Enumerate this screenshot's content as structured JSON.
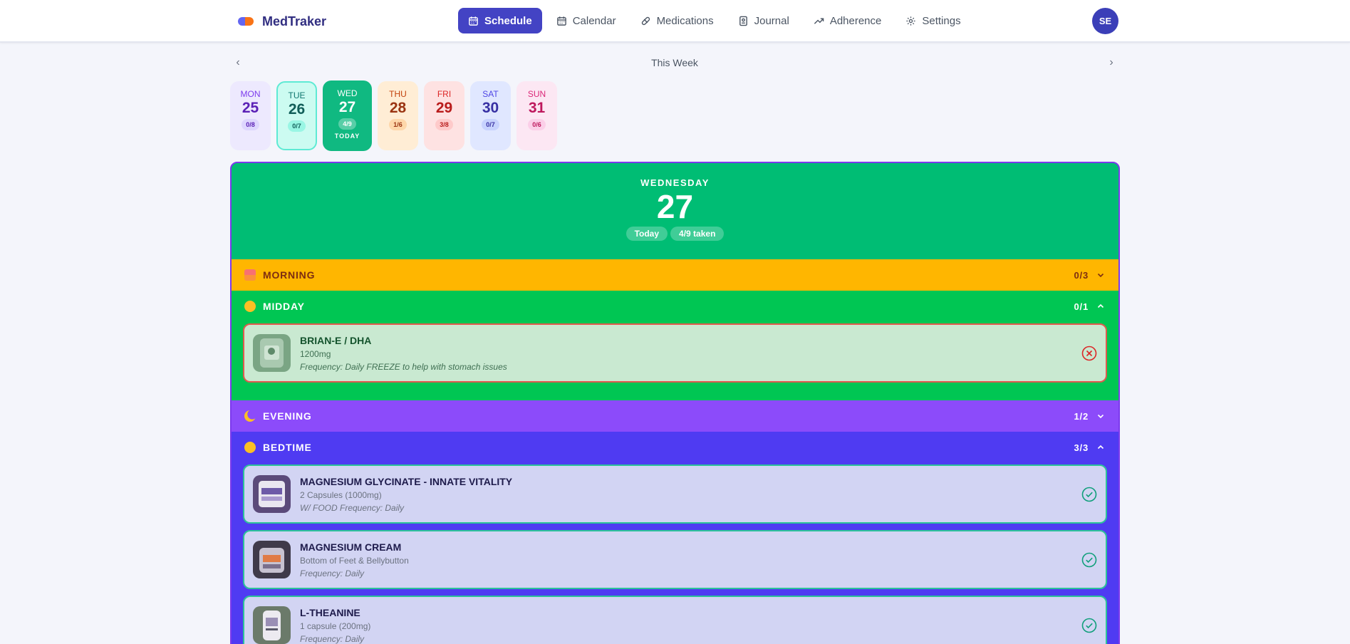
{
  "app": {
    "name": "MedTraker",
    "user_initials": "SE"
  },
  "nav": [
    {
      "label": "Schedule",
      "icon": "calendar-icon",
      "active": true
    },
    {
      "label": "Calendar",
      "icon": "calendar-icon",
      "active": false
    },
    {
      "label": "Medications",
      "icon": "pill-icon",
      "active": false
    },
    {
      "label": "Journal",
      "icon": "journal-icon",
      "active": false
    },
    {
      "label": "Adherence",
      "icon": "trending-up-icon",
      "active": false
    },
    {
      "label": "Settings",
      "icon": "gear-icon",
      "active": false
    }
  ],
  "week": {
    "title": "This Week",
    "days": [
      {
        "name": "MON",
        "num": "25",
        "count": "0/8"
      },
      {
        "name": "TUE",
        "num": "26",
        "count": "0/7"
      },
      {
        "name": "WED",
        "num": "27",
        "count": "4/9",
        "today_label": "TODAY"
      },
      {
        "name": "THU",
        "num": "28",
        "count": "1/6"
      },
      {
        "name": "FRI",
        "num": "29",
        "count": "3/8"
      },
      {
        "name": "SAT",
        "num": "30",
        "count": "0/7"
      },
      {
        "name": "SUN",
        "num": "31",
        "count": "0/6"
      }
    ]
  },
  "selected_day": {
    "weekday": "WEDNESDAY",
    "num": "27",
    "badge_today": "Today",
    "badge_taken": "4/9 taken"
  },
  "sections": {
    "morning": {
      "label": "MORNING",
      "count": "0/3",
      "icon": "sunrise-icon",
      "expanded": false
    },
    "midday": {
      "label": "MIDDAY",
      "count": "0/1",
      "icon": "sun-face-icon",
      "expanded": true,
      "meds": [
        {
          "name": "BRIAN-E / DHA",
          "dose": "1200mg",
          "note": "Frequency: Daily FREEZE to help with stomach issues",
          "status": "missed"
        }
      ]
    },
    "evening": {
      "label": "EVENING",
      "count": "1/2",
      "icon": "moon-icon",
      "expanded": false
    },
    "bedtime": {
      "label": "BEDTIME",
      "count": "3/3",
      "icon": "sleep-face-icon",
      "expanded": true,
      "meds": [
        {
          "name": "MAGNESIUM GLYCINATE - INNATE VITALITY",
          "dose": "2 Capsules (1000mg)",
          "note": "W/ FOOD Frequency: Daily",
          "status": "taken"
        },
        {
          "name": "MAGNESIUM CREAM",
          "dose": "Bottom of Feet & Bellybutton",
          "note": "Frequency: Daily",
          "status": "taken"
        },
        {
          "name": "L-THEANINE",
          "dose": "1 capsule (200mg)",
          "note": "Frequency: Daily",
          "status": "taken"
        }
      ]
    }
  },
  "colors": {
    "accent": "#4343c4",
    "today": "#00bd74",
    "morning": "#ffb600",
    "midday": "#00c653",
    "evening": "#8c4bfa",
    "bedtime": "#4f3bf2"
  }
}
